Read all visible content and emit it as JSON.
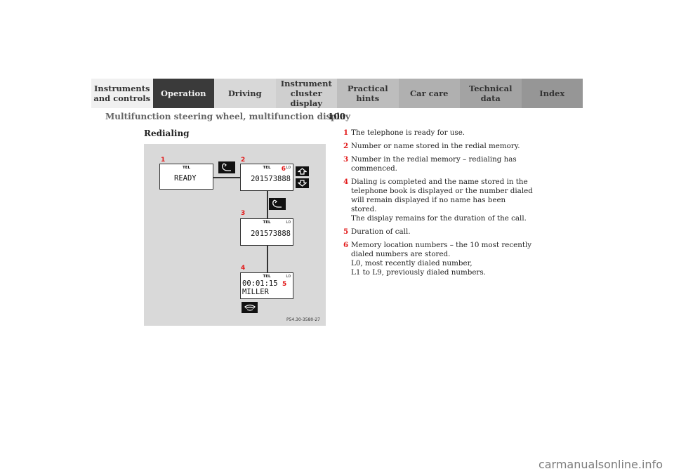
{
  "nav": {
    "tabs": [
      {
        "label": "Instruments\nand controls"
      },
      {
        "label": "Operation"
      },
      {
        "label": "Driving"
      },
      {
        "label": "Instrument\ncluster display"
      },
      {
        "label": "Practical hints"
      },
      {
        "label": "Car care"
      },
      {
        "label": "Technical\ndata"
      },
      {
        "label": "Index"
      }
    ],
    "active_tab": "Operation"
  },
  "header": {
    "running_title": "Multifunction steering wheel, multifunction display",
    "page_number": "100"
  },
  "section": {
    "title": "Redialing"
  },
  "figure": {
    "code": "P54.30-3580-27",
    "callouts": [
      "1",
      "2",
      "3",
      "4",
      "5",
      "6"
    ],
    "displays": [
      {
        "header": "TEL",
        "memory": "",
        "line1": "READY",
        "line2": ""
      },
      {
        "header": "TEL",
        "memory": "L0",
        "line1": "201573888",
        "line2": ""
      },
      {
        "header": "TEL",
        "memory": "L0",
        "line1": "201573888",
        "line2": ""
      },
      {
        "header": "TEL",
        "memory": "L0",
        "line1": "00:01:15",
        "line2": "MILLER"
      }
    ],
    "keys": [
      "phone-pickup",
      "arrow-up",
      "arrow-down",
      "phone-pickup",
      "phone-hangup"
    ]
  },
  "legend": [
    {
      "num": "1",
      "text": "The telephone is ready for use."
    },
    {
      "num": "2",
      "text": "Number or name stored in the redial memory."
    },
    {
      "num": "3",
      "text": "Number in the redial memory – redialing has\ncommenced."
    },
    {
      "num": "4",
      "text": "Dialing is completed and the name stored in the\ntelephone book is displayed or the number dialed\nwill remain displayed if no name has been stored.\nThe display remains for the duration of the call."
    },
    {
      "num": "5",
      "text": "Duration of call."
    },
    {
      "num": "6",
      "text": "Memory location numbers – the 10 most recently\ndialed numbers are stored.\nL0, most recently dialed number,\nL1 to L9, previously dialed numbers."
    }
  ],
  "watermark": "carmanualsonline.info",
  "colors": {
    "callout": "#e21a1a",
    "active_tab": "#3a3a3a"
  }
}
